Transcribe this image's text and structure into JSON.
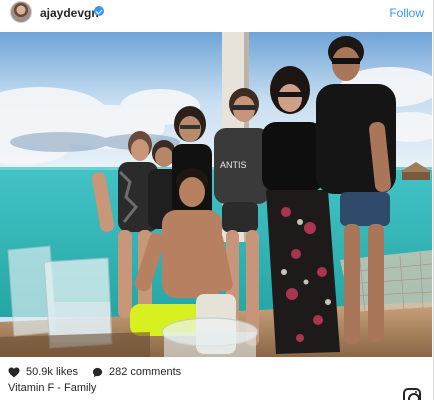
{
  "post": {
    "username": "ajaydevgn",
    "verified": true,
    "follow_label": "Follow",
    "likes": "50.9k likes",
    "comments": "282 comments",
    "caption": "Vitamin F - Family"
  },
  "icons": {
    "avatar": "profile-avatar",
    "verified": "verified-badge-icon",
    "like": "heart-icon",
    "comment": "comment-bubble-icon",
    "brand": "instagram-logo-icon"
  },
  "colors": {
    "link_blue": "#3897f0",
    "text": "#262626",
    "sea": "#3fc2c0",
    "sky": "#bcd9f0"
  }
}
